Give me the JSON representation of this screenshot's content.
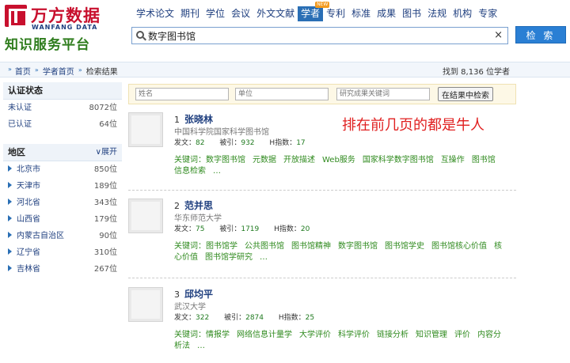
{
  "logo": {
    "cn": "万方数据",
    "en": "WANFANG DATA",
    "slogan": "知识服务平台"
  },
  "nav": [
    {
      "label": "学术论文"
    },
    {
      "label": "期刊"
    },
    {
      "label": "学位"
    },
    {
      "label": "会议"
    },
    {
      "label": "外文文献"
    },
    {
      "label": "学者",
      "active": true,
      "badge": "NEW"
    },
    {
      "label": "专利"
    },
    {
      "label": "标准"
    },
    {
      "label": "成果"
    },
    {
      "label": "图书"
    },
    {
      "label": "法规"
    },
    {
      "label": "机构"
    },
    {
      "label": "专家"
    }
  ],
  "search": {
    "value": "数字图书馆",
    "clear": "×",
    "button": "检 索"
  },
  "breadcrumb": {
    "home": "首页",
    "scholar": "学者首页",
    "current": "检索结果"
  },
  "found": {
    "text": "找到 8,136 位学者"
  },
  "sidebar": {
    "auth_title": "认证状态",
    "auth": [
      {
        "label": "未认证",
        "count": "8072位"
      },
      {
        "label": "已认证",
        "count": "64位"
      }
    ],
    "region_title": "地区",
    "expand": "∨展开",
    "regions": [
      {
        "label": "北京市",
        "count": "850位"
      },
      {
        "label": "天津市",
        "count": "189位"
      },
      {
        "label": "河北省",
        "count": "343位"
      },
      {
        "label": "山西省",
        "count": "179位"
      },
      {
        "label": "内蒙古自治区",
        "count": "90位"
      },
      {
        "label": "辽宁省",
        "count": "310位"
      },
      {
        "label": "吉林省",
        "count": "267位"
      }
    ]
  },
  "filter": {
    "name": "姓名",
    "unit": "单位",
    "keyword": "研究成果关键词",
    "button": "在结果中检索"
  },
  "annotation": "排在前几页的都是牛人",
  "stat_labels": {
    "pubs": "发文：",
    "cites": "被引：",
    "h": "H指数："
  },
  "kw_label": "关键词：",
  "results": [
    {
      "index": "1",
      "name": "张晓林",
      "org": "中国科学院国家科学图书馆",
      "pubs": "82",
      "cites": "932",
      "h": "17",
      "keywords": [
        "数字图书馆",
        "元数据",
        "开放描述",
        "Web服务",
        "国家科学数字图书馆",
        "互操作",
        "图书馆",
        "信息检索",
        "…"
      ]
    },
    {
      "index": "2",
      "name": "范并思",
      "org": "华东师范大学",
      "pubs": "75",
      "cites": "1719",
      "h": "20",
      "keywords": [
        "图书馆学",
        "公共图书馆",
        "图书馆精神",
        "数字图书馆",
        "图书馆学史",
        "图书馆核心价值",
        "核心价值",
        "图书馆学研究",
        "…"
      ]
    },
    {
      "index": "3",
      "name": "邱均平",
      "org": "武汉大学",
      "pubs": "322",
      "cites": "2874",
      "h": "25",
      "keywords": [
        "情报学",
        "网络信息计量学",
        "大学评价",
        "科学评价",
        "链接分析",
        "知识管理",
        "评价",
        "内容分析法",
        "…"
      ]
    }
  ]
}
